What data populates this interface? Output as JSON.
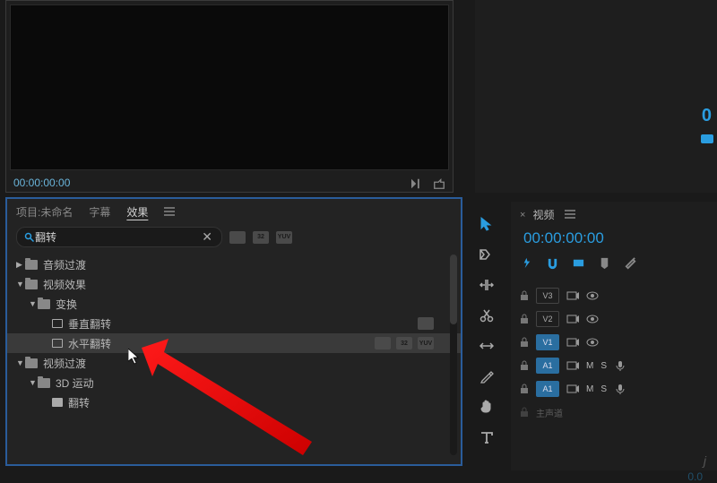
{
  "monitor": {
    "timecode": "00:00:00:00"
  },
  "right_top": {
    "label": "0"
  },
  "panel": {
    "tabs": {
      "project": "项目:未命名",
      "captions": "字幕",
      "effects": "效果"
    },
    "search": {
      "placeholder": "",
      "value": "翻转"
    },
    "badges": [
      "fx",
      "32",
      "YUV"
    ]
  },
  "tree": {
    "audio_transitions": "音频过渡",
    "video_effects": "视频效果",
    "transform": "变换",
    "vflip": "垂直翻转",
    "hflip": "水平翻转",
    "video_transitions": "视频过渡",
    "motion_3d": "3D 运动",
    "flip": "翻转"
  },
  "timeline": {
    "tab": "视频",
    "timecode": "00:00:00:00",
    "tracks": [
      {
        "id": "V3",
        "filled": false,
        "type": "video"
      },
      {
        "id": "V2",
        "filled": false,
        "type": "video"
      },
      {
        "id": "V1",
        "filled": true,
        "type": "video"
      },
      {
        "id": "A1",
        "filled": true,
        "type": "audio",
        "labels": [
          "M",
          "S"
        ]
      },
      {
        "id": "A1",
        "filled": true,
        "type": "audio",
        "labels": [
          "M",
          "S"
        ]
      }
    ],
    "footer": "0.0",
    "master": "主声道"
  },
  "watermark": "j"
}
